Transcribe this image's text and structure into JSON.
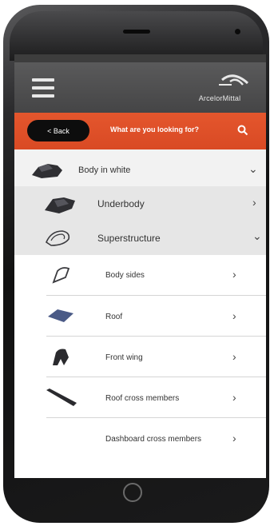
{
  "header": {
    "brand": "ArcelorMittal"
  },
  "searchbar": {
    "back_label": "< Back",
    "prompt": "What are you looking for?"
  },
  "items": [
    {
      "label": "Body in white",
      "chevron": "⌄",
      "level": 0
    },
    {
      "label": "Underbody",
      "chevron": "›",
      "level": 1
    },
    {
      "label": "Superstructure",
      "chevron": "⌄",
      "level": 1
    },
    {
      "label": "Body sides",
      "chevron": "›",
      "level": 2
    },
    {
      "label": "Roof",
      "chevron": "›",
      "level": 2
    },
    {
      "label": "Front wing",
      "chevron": "›",
      "level": 2
    },
    {
      "label": "Roof cross members",
      "chevron": "›",
      "level": 2
    },
    {
      "label": "Dashboard cross members",
      "chevron": "›",
      "level": 2
    }
  ],
  "colors": {
    "accent": "#dd4f27",
    "appbar": "#505051",
    "back_button": "#0d0d0d",
    "selected_bg": "#e6e6e6"
  },
  "icons": {
    "menu": "hamburger-icon",
    "search": "search-icon",
    "logo": "arcelormittal-logo-icon"
  }
}
